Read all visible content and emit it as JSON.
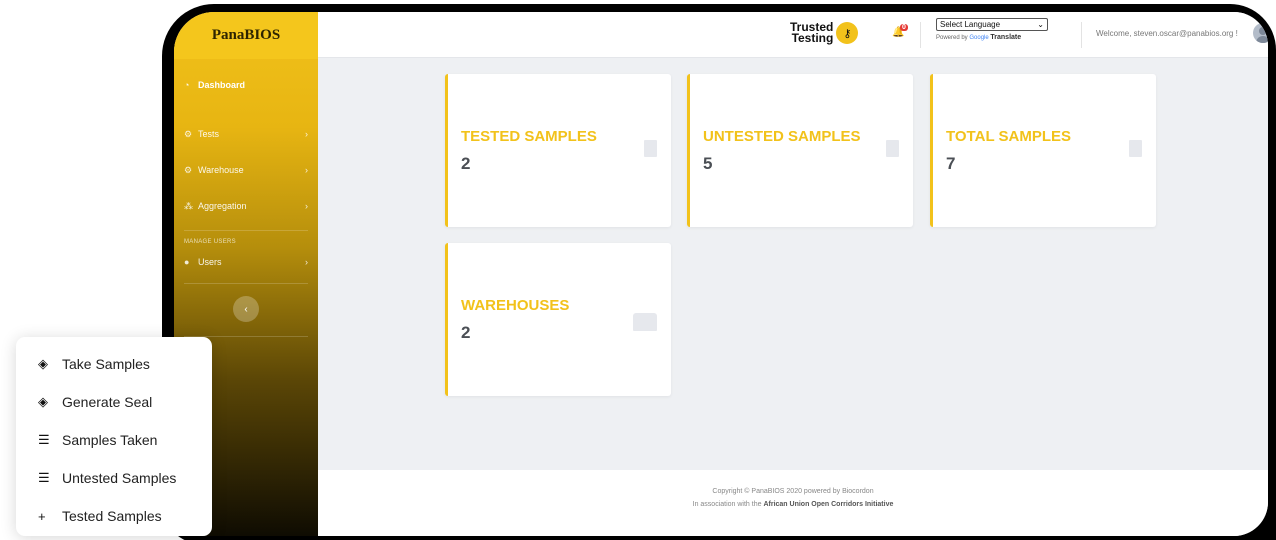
{
  "app": {
    "brand": "PanaBIOS"
  },
  "sidebar": {
    "items": [
      {
        "label": "Dashboard",
        "icon": "dashboard-icon",
        "active": true
      },
      {
        "label": "Tests",
        "icon": "gear-icon"
      },
      {
        "label": "Warehouse",
        "icon": "gear-icon"
      },
      {
        "label": "Aggregation",
        "icon": "sitemap-icon"
      }
    ],
    "section_label": "MANAGE USERS",
    "users_item": {
      "label": "Users",
      "icon": "user-icon"
    },
    "collapse_glyph": "‹"
  },
  "header": {
    "logo_line1": "Trusted",
    "logo_line2": "Testing",
    "notification_count": "0",
    "language_select": "Select Language",
    "powered_by": "Powered by",
    "google": "Google",
    "translate": "Translate",
    "welcome": "Welcome, steven.oscar@panabios.org !"
  },
  "cards": [
    {
      "title": "TESTED SAMPLES",
      "value": "2",
      "icon": "document-icon"
    },
    {
      "title": "UNTESTED SAMPLES",
      "value": "5",
      "icon": "document-icon"
    },
    {
      "title": "TOTAL SAMPLES",
      "value": "7",
      "icon": "document-icon"
    },
    {
      "title": "WAREHOUSES",
      "value": "2",
      "icon": "warehouse-icon"
    }
  ],
  "footer": {
    "copyright": "Copyright © PanaBIOS 2020 powered by Biocordon",
    "assoc_prefix": "In association with the",
    "assoc_org": "African Union Open Corridors Initiative"
  },
  "popup_menu": [
    {
      "label": "Take Samples",
      "icon": "paint-bucket-icon"
    },
    {
      "label": "Generate Seal",
      "icon": "paint-bucket-icon"
    },
    {
      "label": "Samples Taken",
      "icon": "list-icon"
    },
    {
      "label": "Untested Samples",
      "icon": "list-icon"
    },
    {
      "label": "Tested Samples",
      "icon": "plus-icon"
    }
  ],
  "colors": {
    "accent": "#f2c21b",
    "text_dark": "#4b4f55",
    "background": "#eef0f3"
  }
}
